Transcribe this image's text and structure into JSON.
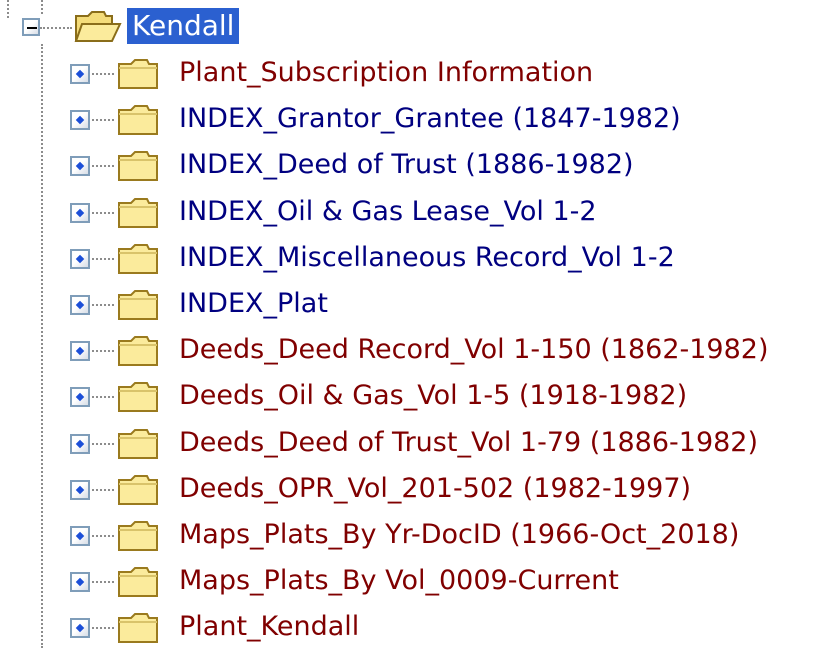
{
  "tree": {
    "root": {
      "label": "Kendall",
      "expanded": true,
      "icon": "open-folder-icon"
    },
    "children": [
      {
        "label": "Plant_Subscription Information",
        "color": "#800000"
      },
      {
        "label": "INDEX_Grantor_Grantee (1847-1982)",
        "color": "#000080"
      },
      {
        "label": "INDEX_Deed of Trust (1886-1982)",
        "color": "#000080"
      },
      {
        "label": "INDEX_Oil & Gas Lease_Vol 1-2",
        "color": "#000080"
      },
      {
        "label": "INDEX_Miscellaneous Record_Vol 1-2",
        "color": "#000080"
      },
      {
        "label": "INDEX_Plat",
        "color": "#000080"
      },
      {
        "label": "Deeds_Deed Record_Vol 1-150 (1862-1982)",
        "color": "#800000"
      },
      {
        "label": "Deeds_Oil & Gas_Vol 1-5 (1918-1982)",
        "color": "#800000"
      },
      {
        "label": "Deeds_Deed of Trust_Vol 1-79 (1886-1982)",
        "color": "#800000"
      },
      {
        "label": "Deeds_OPR_Vol_201-502 (1982-1997)",
        "color": "#800000"
      },
      {
        "label": "Maps_Plats_By Yr-DocID (1966-Oct_2018)",
        "color": "#800000"
      },
      {
        "label": "Maps_Plats_By Vol_0009-Current",
        "color": "#800000"
      },
      {
        "label": "Plant_Kendall",
        "color": "#800000"
      }
    ]
  },
  "colors": {
    "selection": "#2b60d0",
    "folder_fill": "#fbeb9c",
    "folder_stroke": "#9a7a1e",
    "expander_dot": "#1c4fd8"
  }
}
